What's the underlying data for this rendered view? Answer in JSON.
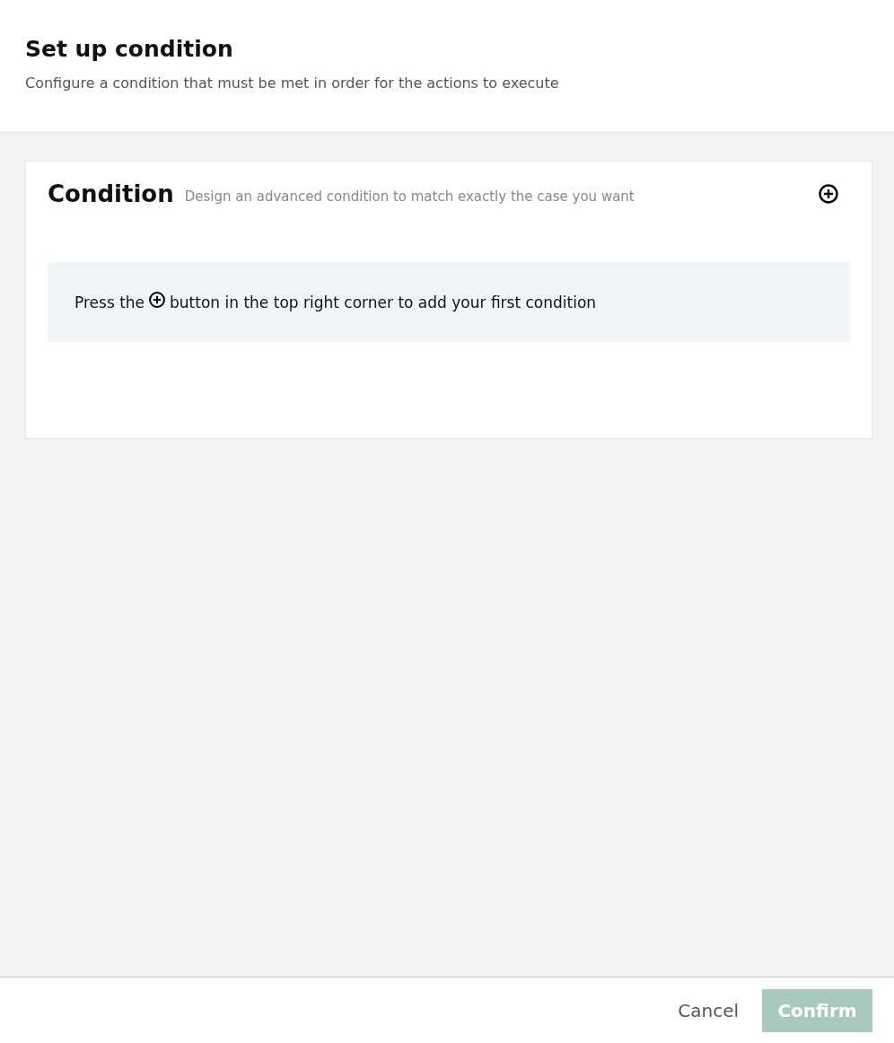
{
  "header": {
    "title": "Set up condition",
    "subtitle": "Configure a condition that must be met in order for the actions to execute"
  },
  "card": {
    "title": "Condition",
    "subtitle": "Design an advanced condition to match exactly the case you want",
    "hint_before": "Press the",
    "hint_after": "button in the top right corner to add your first condition"
  },
  "footer": {
    "buttons": [
      {
        "kind": "text",
        "label": "Cancel",
        "disabled": false
      },
      {
        "kind": "primary",
        "label": "Confirm",
        "disabled": true
      }
    ]
  }
}
